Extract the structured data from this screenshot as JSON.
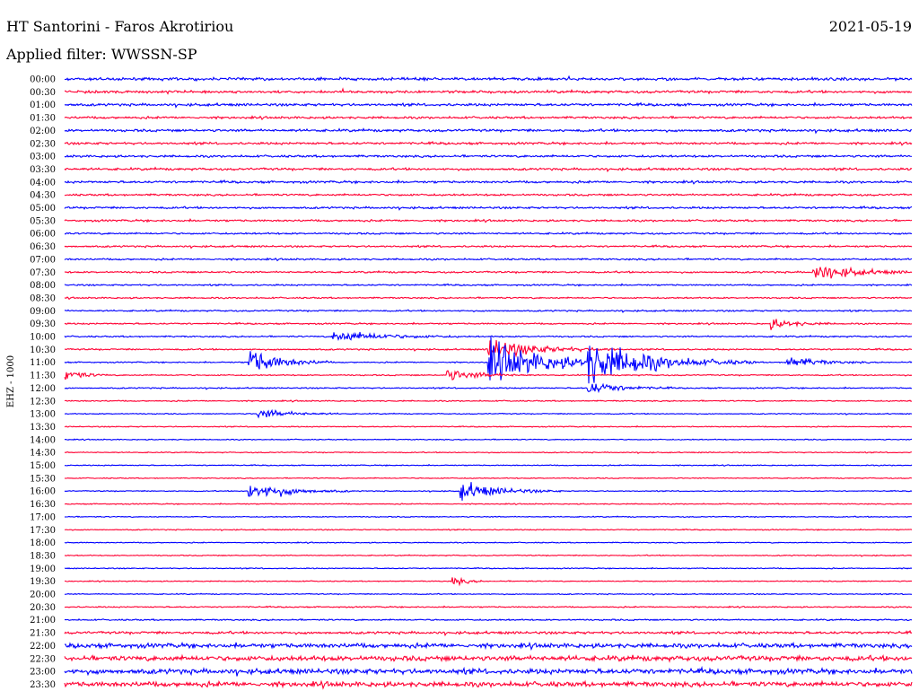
{
  "header": {
    "title": "HT Santorini - Faros Akrotiriou",
    "date": "2021-05-19",
    "filter": "Applied filter: WWSSN-SP"
  },
  "chart_data": {
    "type": "line",
    "ylabel": "EHZ - 1000",
    "row_labels": [
      "00:00",
      "00:30",
      "01:00",
      "01:30",
      "02:00",
      "02:30",
      "03:00",
      "03:30",
      "04:00",
      "04:30",
      "05:00",
      "05:30",
      "06:00",
      "06:30",
      "07:00",
      "07:30",
      "08:00",
      "08:30",
      "09:00",
      "09:30",
      "10:00",
      "10:30",
      "11:00",
      "11:30",
      "12:00",
      "12:30",
      "13:00",
      "13:30",
      "14:00",
      "14:30",
      "15:00",
      "15:30",
      "16:00",
      "16:30",
      "17:00",
      "17:30",
      "18:00",
      "18:30",
      "19:00",
      "19:30",
      "20:00",
      "20:30",
      "21:00",
      "21:30",
      "22:00",
      "22:30",
      "23:00",
      "23:30"
    ],
    "row_minutes": 30,
    "colors": [
      "#0000ff",
      "#ff0033"
    ],
    "noise_level": [
      0.55,
      0.5,
      0.5,
      0.45,
      0.5,
      0.45,
      0.45,
      0.45,
      0.45,
      0.4,
      0.4,
      0.4,
      0.35,
      0.35,
      0.35,
      0.35,
      0.3,
      0.3,
      0.3,
      0.3,
      0.3,
      0.3,
      0.25,
      0.25,
      0.25,
      0.25,
      0.2,
      0.2,
      0.2,
      0.2,
      0.2,
      0.2,
      0.2,
      0.2,
      0.2,
      0.2,
      0.2,
      0.2,
      0.2,
      0.2,
      0.2,
      0.25,
      0.3,
      0.5,
      0.9,
      1.0,
      1.0,
      1.0
    ],
    "events": [
      {
        "row": 21,
        "minute": 15.0,
        "amplitude": 1.6,
        "duration": 1.5
      },
      {
        "row": 22,
        "minute": 6.5,
        "amplitude": 2.2,
        "duration": 1.0
      },
      {
        "row": 22,
        "minute": 15.0,
        "amplitude": 3.2,
        "duration": 2.0
      },
      {
        "row": 22,
        "minute": 18.5,
        "amplitude": 3.2,
        "duration": 2.0
      },
      {
        "row": 22,
        "minute": 25.5,
        "amplitude": 1.0,
        "duration": 1.0
      },
      {
        "row": 23,
        "minute": 0.0,
        "amplitude": 1.2,
        "duration": 0.5
      },
      {
        "row": 23,
        "minute": 13.5,
        "amplitude": 1.0,
        "duration": 1.0
      },
      {
        "row": 24,
        "minute": 18.5,
        "amplitude": 1.0,
        "duration": 1.0
      },
      {
        "row": 26,
        "minute": 6.8,
        "amplitude": 0.8,
        "duration": 1.0
      },
      {
        "row": 32,
        "minute": 6.5,
        "amplitude": 1.5,
        "duration": 1.2
      },
      {
        "row": 32,
        "minute": 14.0,
        "amplitude": 1.4,
        "duration": 1.2
      },
      {
        "row": 15,
        "minute": 26.5,
        "amplitude": 1.3,
        "duration": 1.2
      },
      {
        "row": 20,
        "minute": 9.5,
        "amplitude": 0.9,
        "duration": 1.5
      },
      {
        "row": 19,
        "minute": 25.0,
        "amplitude": 0.8,
        "duration": 0.8
      },
      {
        "row": 39,
        "minute": 13.7,
        "amplitude": 0.9,
        "duration": 0.4
      }
    ]
  }
}
